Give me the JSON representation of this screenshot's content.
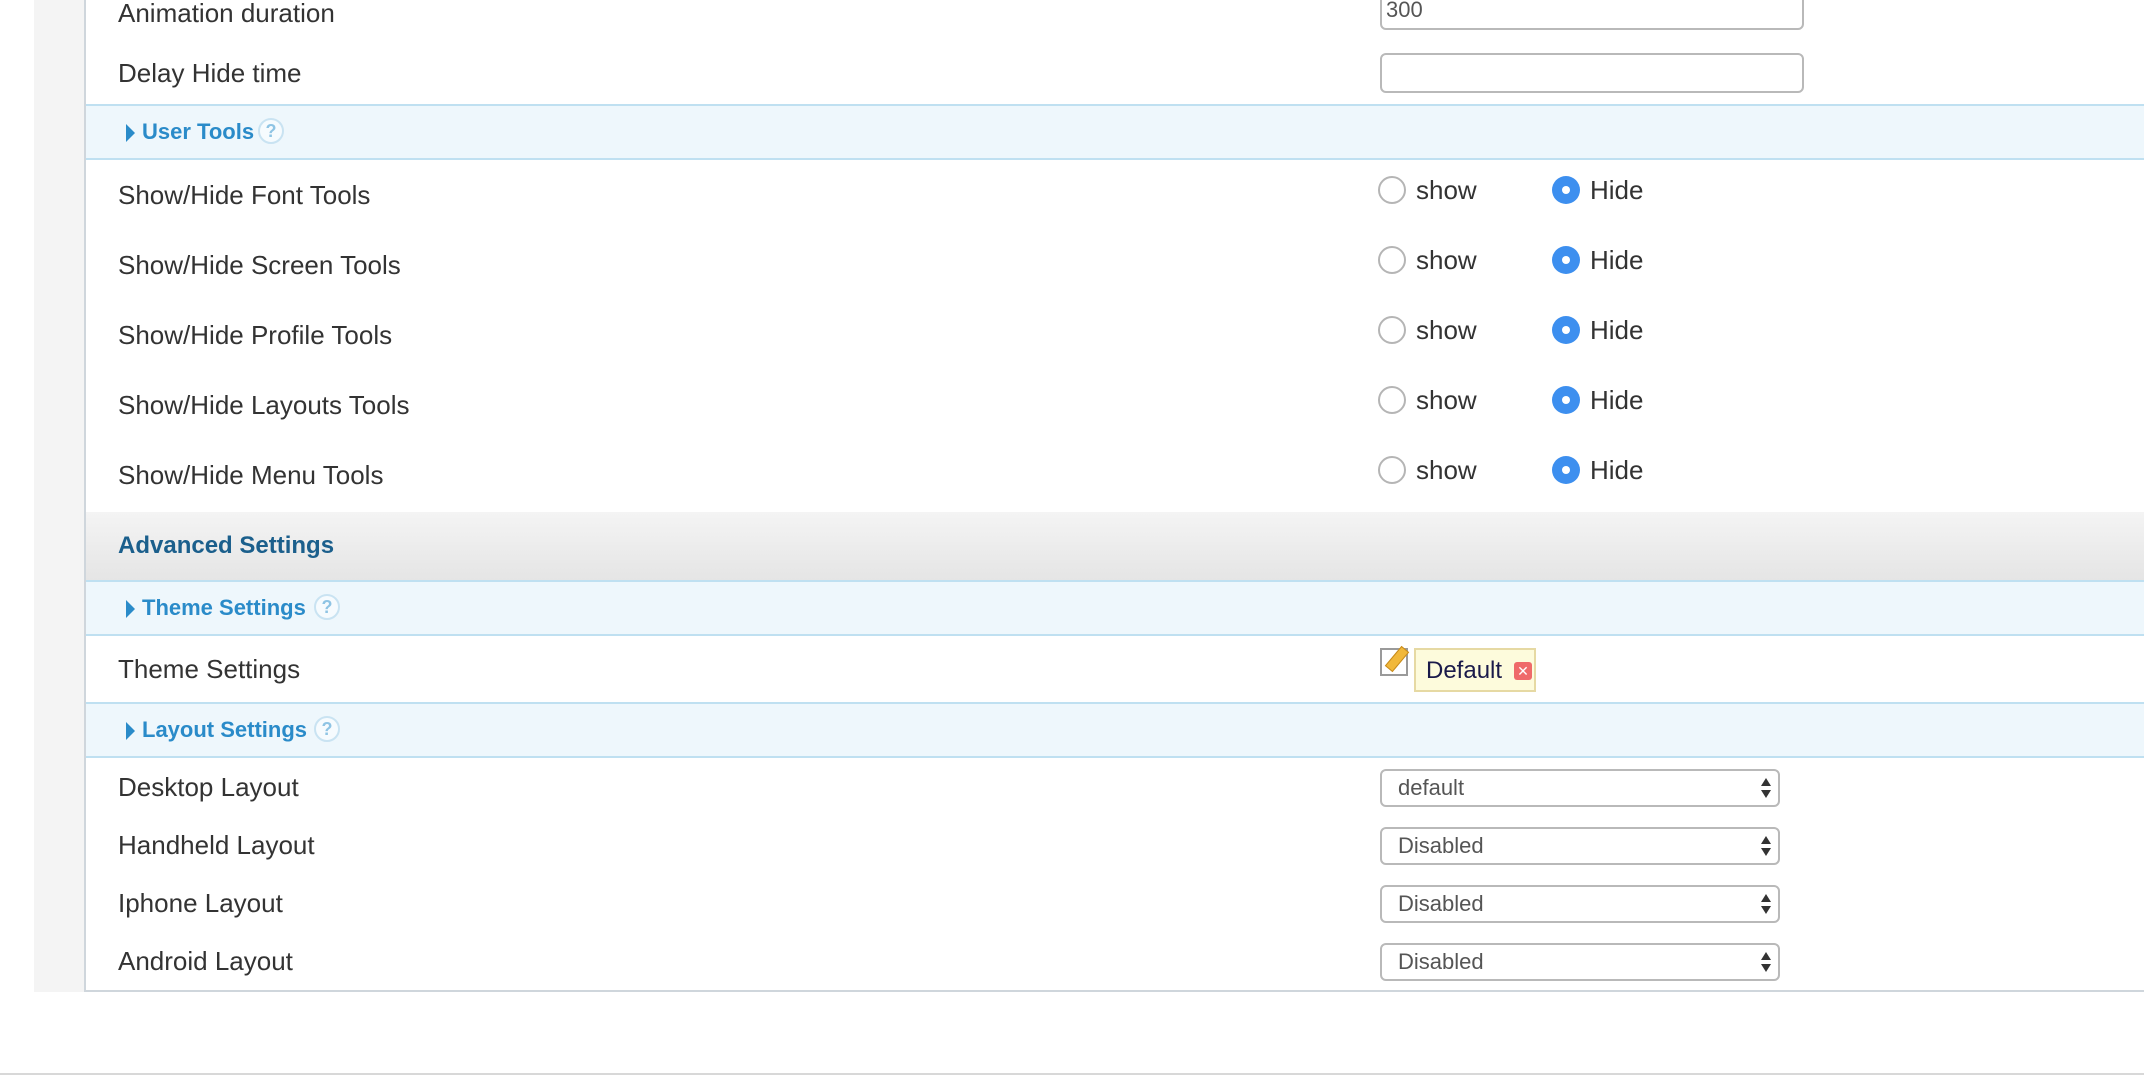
{
  "general": {
    "animation_duration": {
      "label": "Animation duration",
      "value": "300"
    },
    "delay_hide_time": {
      "label": "Delay Hide time",
      "value": ""
    }
  },
  "user_tools": {
    "header": "User Tools",
    "help": "?",
    "rows": [
      {
        "label": "Show/Hide Font Tools",
        "show_label": "show",
        "hide_label": "Hide",
        "selected": "Hide"
      },
      {
        "label": "Show/Hide Screen Tools",
        "show_label": "show",
        "hide_label": "Hide",
        "selected": "Hide"
      },
      {
        "label": "Show/Hide Profile Tools",
        "show_label": "show",
        "hide_label": "Hide",
        "selected": "Hide"
      },
      {
        "label": "Show/Hide Layouts Tools",
        "show_label": "show",
        "hide_label": "Hide",
        "selected": "Hide"
      },
      {
        "label": "Show/Hide Menu Tools",
        "show_label": "show",
        "hide_label": "Hide",
        "selected": "Hide"
      }
    ]
  },
  "advanced": {
    "title": "Advanced Settings"
  },
  "theme_settings": {
    "header": "Theme Settings",
    "help": "?",
    "row_label": "Theme Settings",
    "selected_theme": "Default",
    "remove_glyph": "✕"
  },
  "layout_settings": {
    "header": "Layout Settings",
    "help": "?",
    "rows": [
      {
        "label": "Desktop Layout",
        "value": "default"
      },
      {
        "label": "Handheld Layout",
        "value": "Disabled"
      },
      {
        "label": "Iphone Layout",
        "value": "Disabled"
      },
      {
        "label": "Android Layout",
        "value": "Disabled"
      }
    ]
  },
  "colors": {
    "accent": "#2a8bc9",
    "radio_checked": "#3d8fef",
    "section_title": "#1b5f8c",
    "group_header_bg": "#eef7fc"
  }
}
